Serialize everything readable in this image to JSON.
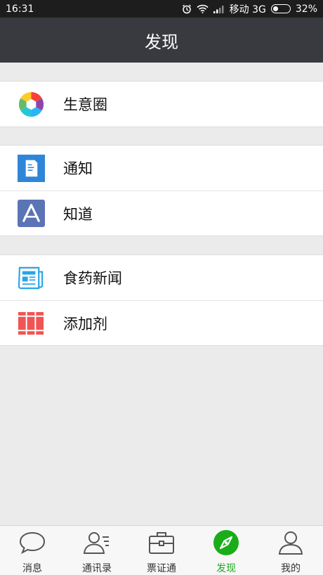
{
  "status_bar": {
    "time": "16:31",
    "carrier": "移动 3G",
    "battery": "32%",
    "battery_level": 0.32
  },
  "header": {
    "title": "发现"
  },
  "groups": [
    {
      "items": [
        {
          "label": "生意圈",
          "icon": "aperture-icon"
        }
      ]
    },
    {
      "items": [
        {
          "label": "通知",
          "icon": "notice-document-icon"
        },
        {
          "label": "知道",
          "icon": "app-store-icon"
        }
      ]
    },
    {
      "items": [
        {
          "label": "食药新闻",
          "icon": "newspaper-icon"
        },
        {
          "label": "添加剂",
          "icon": "books-icon"
        }
      ]
    }
  ],
  "tabbar": {
    "tabs": [
      {
        "label": "消息",
        "icon": "chat-bubble-icon"
      },
      {
        "label": "通讯录",
        "icon": "contacts-icon"
      },
      {
        "label": "票证通",
        "icon": "briefcase-icon"
      },
      {
        "label": "发现",
        "icon": "compass-icon",
        "active": true
      },
      {
        "label": "我的",
        "icon": "person-icon"
      }
    ]
  },
  "colors": {
    "header_bg": "#393a3f",
    "active_tab": "#1aad19",
    "background": "#ebebeb"
  }
}
